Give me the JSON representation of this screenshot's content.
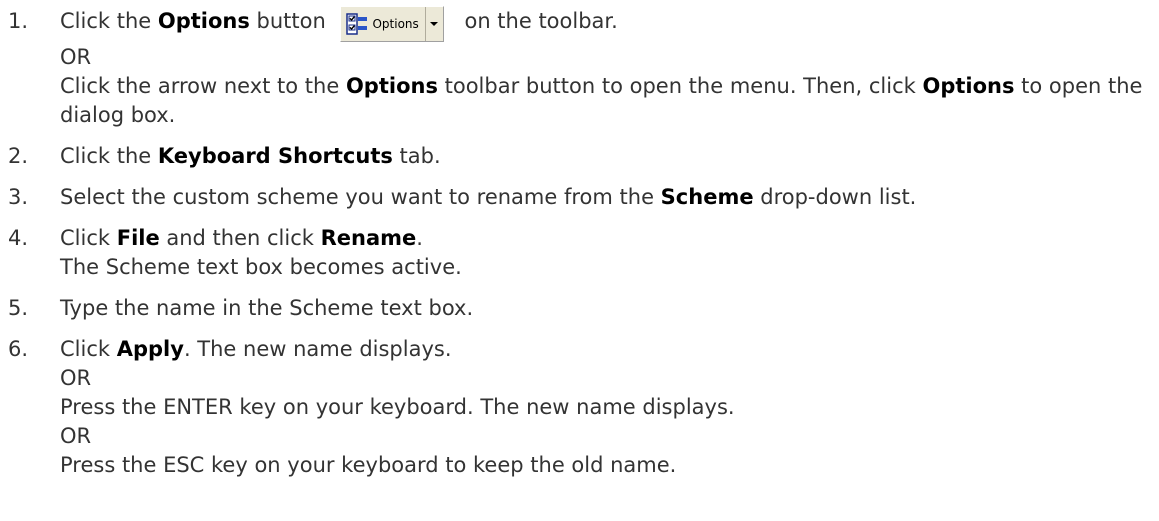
{
  "toolbar_button": {
    "label": "Options",
    "icon": "options-checklist-icon",
    "arrow_icon": "dropdown-arrow-icon"
  },
  "steps": [
    {
      "number": "1.",
      "pre": "Click the ",
      "bold": "Options",
      "mid": " button ",
      "post": " on the toolbar.",
      "or1": "OR",
      "alt_pre": "Click the arrow next to the ",
      "alt_bold1": "Options",
      "alt_mid": " toolbar button to open the menu. Then, click ",
      "alt_bold2": "Options",
      "alt_post": " to open the dialog box."
    },
    {
      "number": "2.",
      "pre": "Click the ",
      "bold": "Keyboard Shortcuts",
      "post": " tab."
    },
    {
      "number": "3.",
      "pre": "Select the custom scheme you want to rename from the ",
      "bold": "Scheme",
      "post": " drop-down list."
    },
    {
      "number": "4.",
      "pre": "Click ",
      "bold1": "File",
      "mid": " and then click ",
      "bold2": "Rename",
      "post": ".",
      "note": "The Scheme text box becomes active."
    },
    {
      "number": "5.",
      "text": "Type the name in the Scheme text box."
    },
    {
      "number": "6.",
      "pre": "Click ",
      "bold": "Apply",
      "post": ". The new name displays.",
      "or1": "OR",
      "alt1": "Press the ENTER key on your keyboard. The new name displays.",
      "or2": "OR",
      "alt2": "Press the ESC key on your keyboard to keep the old name."
    }
  ]
}
